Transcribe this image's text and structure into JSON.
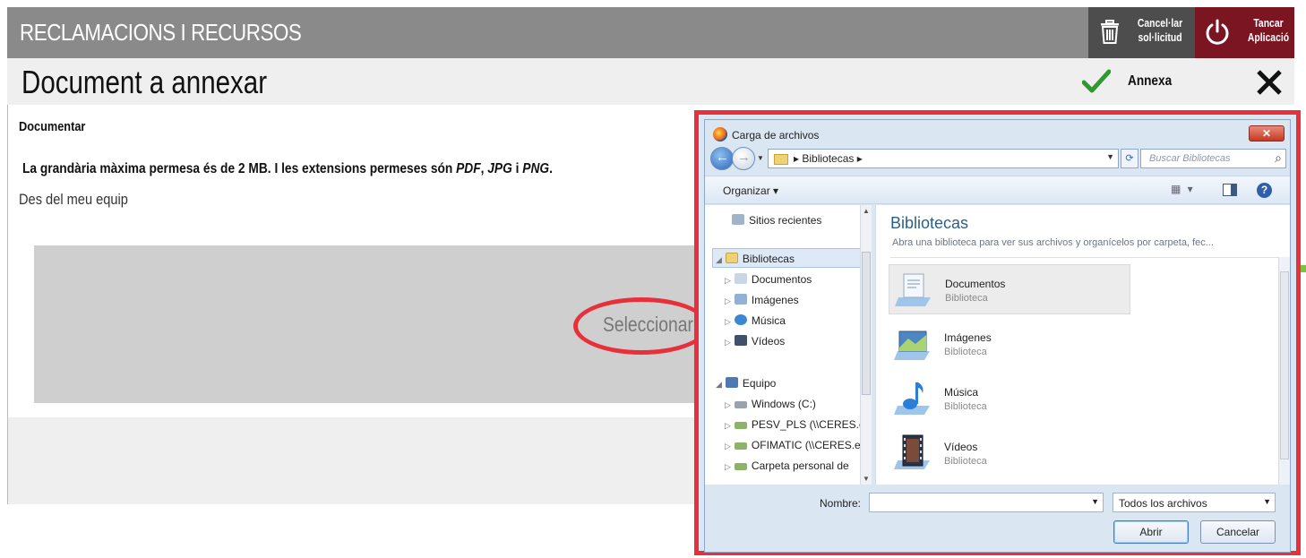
{
  "app": {
    "title": "RECLAMACIONS I RECURSOS",
    "cancel_label_line1": "Cancel·lar",
    "cancel_label_line2": "sol·licitud",
    "close_label_line1": "Tancar",
    "close_label_line2": "Aplicació",
    "colors": {
      "header_bg": "#8a8a8a",
      "cancel_bg": "#4d4d4d",
      "close_bg": "#7a1521",
      "accept_green": "#2e9a2e",
      "highlight_red": "#e8303a"
    }
  },
  "page": {
    "title": "Document a annexar",
    "annexa_label": "Annexa"
  },
  "upload": {
    "section_label": "Documentar",
    "info_prefix": "La grandària màxima permesa és de 2 MB. I les extensions permeses són ",
    "ext_pdf": "PDF",
    "sep1": ", ",
    "ext_jpg": "JPG",
    "sep2": " i ",
    "ext_png": "PNG",
    "info_suffix": ".",
    "source_label": "Des del meu equip",
    "select_label": "Seleccionar"
  },
  "dialog": {
    "title": "Carga de archivos",
    "address": "▸ Bibliotecas ▸",
    "search_placeholder": "Buscar Bibliotecas",
    "organize_label": "Organizar ▾",
    "nav_items": [
      {
        "label": "Sitios recientes",
        "icon": "recent-places-icon"
      },
      {
        "label": "Bibliotecas",
        "icon": "libraries-icon"
      },
      {
        "label": "Documentos",
        "icon": "documents-icon"
      },
      {
        "label": "Imágenes",
        "icon": "images-icon"
      },
      {
        "label": "Música",
        "icon": "music-icon"
      },
      {
        "label": "Vídeos",
        "icon": "videos-icon"
      },
      {
        "label": "Equipo",
        "icon": "computer-icon"
      },
      {
        "label": "Windows (C:)",
        "icon": "drive-icon"
      },
      {
        "label": "PESV_PLS (\\\\CERES.ec",
        "icon": "network-drive-icon"
      },
      {
        "label": "OFIMATIC (\\\\CERES.e",
        "icon": "network-drive-icon"
      },
      {
        "label": "Carpeta personal de",
        "icon": "network-drive-icon"
      }
    ],
    "content_title": "Bibliotecas",
    "content_desc": "Abra una biblioteca para ver sus archivos y organícelos por carpeta, fec...",
    "libraries": [
      {
        "name": "Documentos",
        "sub": "Biblioteca"
      },
      {
        "name": "Imágenes",
        "sub": "Biblioteca"
      },
      {
        "name": "Música",
        "sub": "Biblioteca"
      },
      {
        "name": "Vídeos",
        "sub": "Biblioteca"
      }
    ],
    "name_label": "Nombre:",
    "name_value": "",
    "filter_value": "Todos los archivos",
    "open_label": "Abrir",
    "cancel_label": "Cancelar"
  }
}
